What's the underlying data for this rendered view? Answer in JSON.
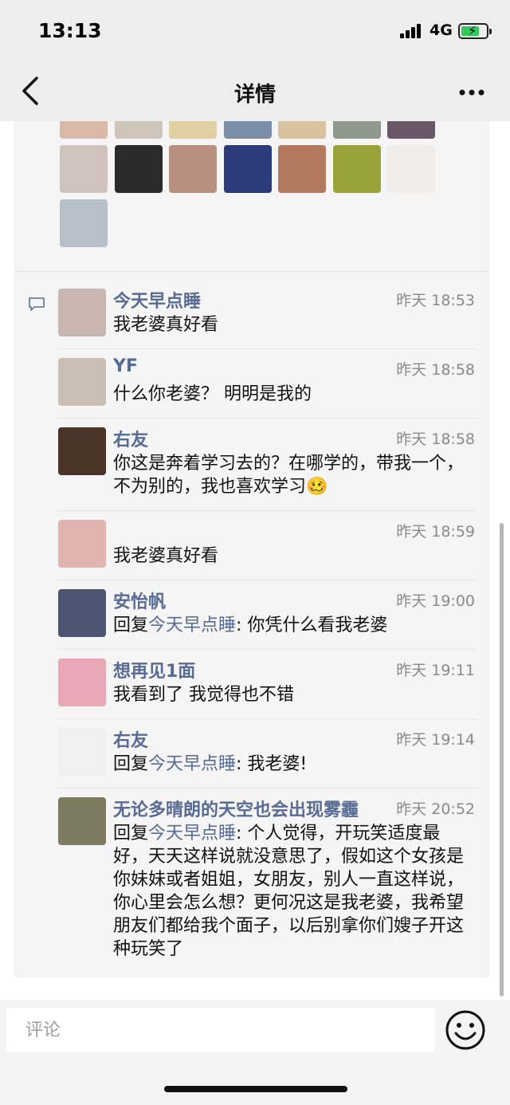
{
  "status_bar": {
    "time": "13:13",
    "network": "4G",
    "battery_charging": true
  },
  "nav": {
    "title": "详情",
    "back_icon": "chevron-left-icon",
    "more_icon": "more-dots-icon"
  },
  "likes_avatar_colors": [
    "#d9b9a8",
    "#cfc6bb",
    "#e0cfa0",
    "#7c8fa8",
    "#d8c2a0",
    "#8f9a8c",
    "#6a5868",
    "#cfc3bd",
    "#2b2b2b",
    "#b89080",
    "#2c3c7a",
    "#b27a5e",
    "#9aa23a",
    "#f2ece8",
    "#b8c0cc"
  ],
  "comments": [
    {
      "name": "今天早点睡",
      "time": "昨天 18:53",
      "text": "我老婆真好看",
      "reply_to": "",
      "avatar_color": "#c7b7b0"
    },
    {
      "name": "YF",
      "time": "昨天 18:58",
      "text": "什么你老婆？ 明明是我的",
      "reply_to": "",
      "avatar_color": "#c9bfb5"
    },
    {
      "name": "右友",
      "time": "昨天 18:58",
      "text": "你这是奔着学习去的？在哪学的，带我一个，不为别的，我也喜欢学习🥴",
      "reply_to": "",
      "avatar_color": "#4a3428"
    },
    {
      "name": "",
      "time": "昨天 18:59",
      "text": "我老婆真好看",
      "reply_to": "",
      "avatar_color": "#e2b4b0"
    },
    {
      "name": "安怡帆",
      "time": "昨天 19:00",
      "text": ": 你凭什么看我老婆",
      "reply_prefix": "回复",
      "reply_to": "今天早点睡",
      "avatar_color": "#4c5672"
    },
    {
      "name": "想再见1面",
      "time": "昨天 19:11",
      "text": "我看到了 我觉得也不错",
      "reply_to": "",
      "avatar_color": "#e9a8b6"
    },
    {
      "name": "右友",
      "time": "昨天 19:14",
      "text": ": 我老婆!",
      "reply_prefix": "回复",
      "reply_to": "今天早点睡",
      "avatar_color": "#f0f0f0"
    },
    {
      "name": "无论多晴朗的天空也会出现雾霾",
      "time": "昨天 20:52",
      "text": ": 个人觉得，开玩笑适度最好，天天这样说就没意思了，假如这个女孩是你妹妹或者姐姐，女朋友，别人一直这样说，你心里会怎么想？更何况这是我老婆，我希望朋友们都给我个面子，以后别拿你们嫂子开这种玩笑了",
      "reply_prefix": "回复",
      "reply_to": "今天早点睡",
      "avatar_color": "#7e7a62"
    }
  ],
  "input": {
    "placeholder": "评论",
    "emoji_icon": "smiley-icon"
  },
  "colors": {
    "link": "#576b95",
    "nav_bg": "#ededed",
    "content_bg": "#f5f5f5"
  }
}
